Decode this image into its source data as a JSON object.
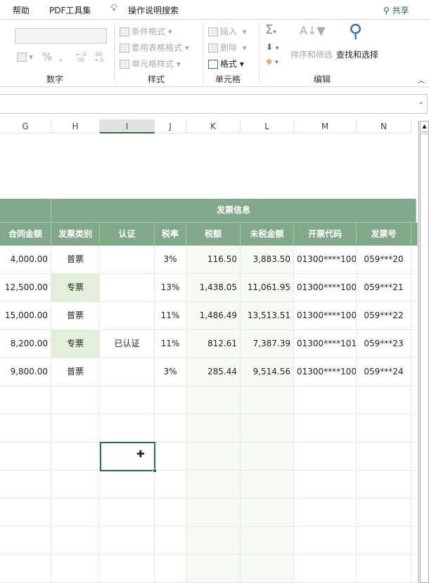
{
  "menu": {
    "help": "帮助",
    "pdf": "PDF工具集",
    "search": "操作说明搜索",
    "share": "共享"
  },
  "ribbon": {
    "number": {
      "label": "数字",
      "percent": "%",
      "comma": ",",
      "inc_decimal": "←.0 .00",
      "dec_decimal": ".00 →.0"
    },
    "styles": {
      "label": "样式",
      "conditional": "条件格式",
      "table": "套用表格格式",
      "cell": "单元格样式"
    },
    "cells": {
      "label": "单元格",
      "insert": "插入",
      "delete": "删除",
      "format": "格式"
    },
    "editing": {
      "label": "编辑",
      "sum": "Σ",
      "sort": "排序和筛选",
      "find": "查找和选择"
    }
  },
  "columns": [
    "G",
    "H",
    "I",
    "J",
    "K",
    "L",
    "M",
    "N"
  ],
  "selected_column": "I",
  "table": {
    "group_header": "发票信息",
    "headers": [
      "合同金额",
      "发票类别",
      "认证",
      "税率",
      "税额",
      "未税金额",
      "开票代码",
      "发票号"
    ],
    "rows": [
      [
        "4,000.00",
        "普票",
        "",
        "3%",
        "116.50",
        "3,883.50",
        "01300****100",
        "059***20"
      ],
      [
        "12,500.00",
        "专票",
        "",
        "13%",
        "1,438.05",
        "11,061.95",
        "01300****100",
        "059***21"
      ],
      [
        "15,000.00",
        "普票",
        "",
        "11%",
        "1,486.49",
        "13,513.51",
        "01300****100",
        "059***22"
      ],
      [
        "8,200.00",
        "专票",
        "已认证",
        "11%",
        "812.61",
        "7,387.39",
        "01300****101",
        "059***23"
      ],
      [
        "9,800.00",
        "普票",
        "",
        "3%",
        "285.44",
        "9,514.56",
        "01300****100",
        "059***24"
      ]
    ]
  },
  "colors": {
    "header": "#80a889",
    "special": "#e2efda",
    "tint": "#f7faf4",
    "select": "#217346"
  }
}
